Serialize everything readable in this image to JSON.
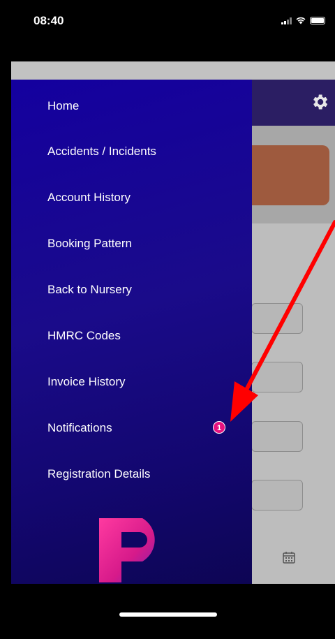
{
  "status_bar": {
    "time": "08:40"
  },
  "menu": {
    "items": [
      {
        "label": "Home"
      },
      {
        "label": "Accidents / Incidents"
      },
      {
        "label": "Account History"
      },
      {
        "label": "Booking Pattern"
      },
      {
        "label": "Back to Nursery"
      },
      {
        "label": "HMRC Codes"
      },
      {
        "label": "Invoice History"
      },
      {
        "label": "Notifications",
        "badge": "1"
      },
      {
        "label": "Registration Details"
      }
    ]
  },
  "icons": {
    "settings": "gear-icon",
    "calendar": "calendar-icon",
    "logo": "app-logo"
  },
  "colors": {
    "drawer": "#14009f",
    "header": "#2b1e63",
    "badge": "#e6127f",
    "card": "#9e5a3e",
    "arrow": "#ff0000"
  }
}
